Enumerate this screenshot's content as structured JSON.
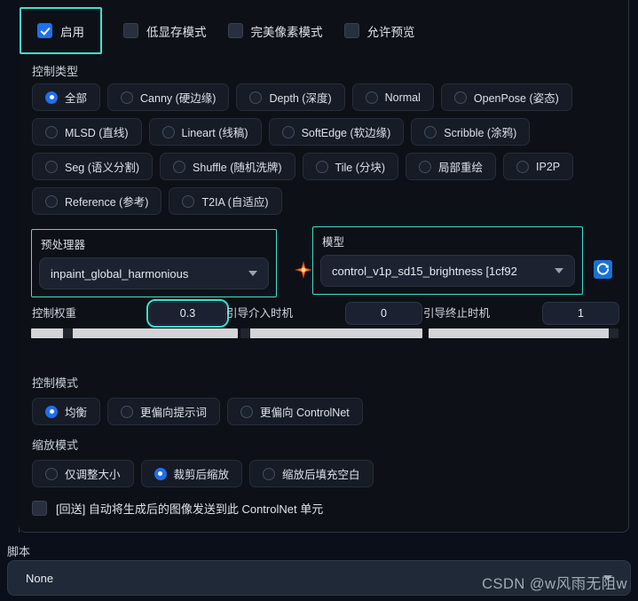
{
  "checkbox_row": [
    {
      "label": "启用",
      "checked": true,
      "highlighted": true
    },
    {
      "label": "低显存模式",
      "checked": false,
      "highlighted": false
    },
    {
      "label": "完美像素模式",
      "checked": false,
      "highlighted": false
    },
    {
      "label": "允许预览",
      "checked": false,
      "highlighted": false
    }
  ],
  "control_type": {
    "label": "控制类型",
    "rows": [
      [
        {
          "label": "全部",
          "selected": true
        },
        {
          "label": "Canny (硬边缘)",
          "selected": false
        },
        {
          "label": "Depth (深度)",
          "selected": false
        },
        {
          "label": "Normal",
          "selected": false
        },
        {
          "label": "OpenPose (姿态)",
          "selected": false
        }
      ],
      [
        {
          "label": "MLSD (直线)",
          "selected": false
        },
        {
          "label": "Lineart (线稿)",
          "selected": false
        },
        {
          "label": "SoftEdge (软边缘)",
          "selected": false
        },
        {
          "label": "Scribble (涂鸦)",
          "selected": false
        }
      ],
      [
        {
          "label": "Seg (语义分割)",
          "selected": false
        },
        {
          "label": "Shuffle (随机洗牌)",
          "selected": false
        },
        {
          "label": "Tile (分块)",
          "selected": false
        },
        {
          "label": "局部重绘",
          "selected": false
        },
        {
          "label": "IP2P",
          "selected": false
        }
      ],
      [
        {
          "label": "Reference (参考)",
          "selected": false
        },
        {
          "label": "T2IA (自适应)",
          "selected": false
        }
      ]
    ]
  },
  "preprocessor": {
    "caption": "预处理器",
    "value": "inpaint_global_harmonious"
  },
  "model": {
    "caption": "模型",
    "value": "control_v1p_sd15_brightness [1cf92"
  },
  "sparkle_icon": "sparkle-star-icon",
  "refresh_icon": "refresh-icon",
  "sliders": [
    {
      "label": "控制权重",
      "value": "0.3",
      "fraction": 0.155,
      "highlighted": true
    },
    {
      "label": "引导介入时机",
      "value": "0",
      "fraction": 0.0,
      "highlighted": false
    },
    {
      "label": "引导终止时机",
      "value": "1",
      "fraction": 1.0,
      "highlighted": false
    }
  ],
  "control_mode": {
    "label": "控制模式",
    "options": [
      {
        "label": "均衡",
        "selected": true
      },
      {
        "label": "更偏向提示词",
        "selected": false
      },
      {
        "label": "更偏向 ControlNet",
        "selected": false
      }
    ]
  },
  "resize_mode": {
    "label": "缩放模式",
    "options": [
      {
        "label": "仅调整大小",
        "selected": false
      },
      {
        "label": "裁剪后缩放",
        "selected": true
      },
      {
        "label": "缩放后填充空白",
        "selected": false
      }
    ]
  },
  "send_back": {
    "label": "[回送] 自动将生成后的图像发送到此 ControlNet 单元",
    "checked": false
  },
  "script": {
    "label": "脚本",
    "value": "None"
  },
  "watermark": "CSDN @w风雨无阻w",
  "colors": {
    "background": "#0b0f19",
    "panel": "#0d1117",
    "accent_highlight": "#3fe0d0",
    "accent_blue": "#1f6feb",
    "slider_track": "#d2d4d7",
    "sparkle": "#ff5a1f"
  }
}
